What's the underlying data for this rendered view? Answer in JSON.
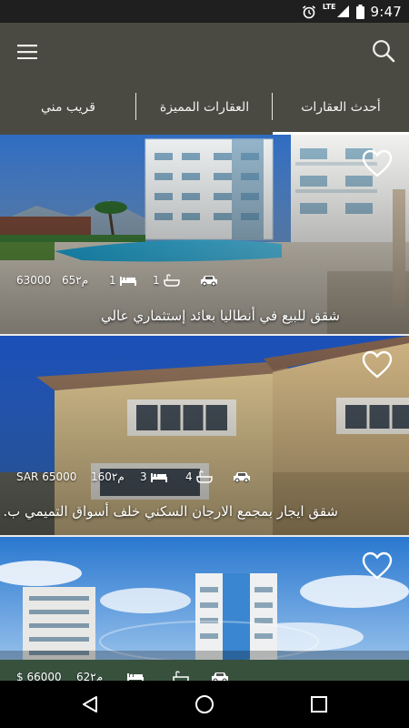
{
  "status_bar": {
    "time": "9:47",
    "network": "LTE",
    "icons": [
      "alarm-icon",
      "signal-icon",
      "battery-icon"
    ]
  },
  "app_bar": {
    "icons": [
      "menu-icon",
      "search-icon"
    ]
  },
  "tabs": [
    {
      "label": "أحدث العقارات",
      "active": true
    },
    {
      "label": "العقارات المميزة",
      "active": false
    },
    {
      "label": "قريب مني",
      "active": false
    }
  ],
  "listings": [
    {
      "title": "شقق للبيع في أنطاليا بعائد إستثماري عالي",
      "price": "63000",
      "area": "65م٢",
      "bedrooms": "1",
      "bathrooms": "1",
      "favorited": false
    },
    {
      "title": "شقق ايجار بمجمع الارجان السكني خلف أسواق التميمي ب.",
      "price": "SAR 65000",
      "area": "160م٢",
      "bedrooms": "3",
      "bathrooms": "4",
      "favorited": false
    },
    {
      "title": "",
      "price": "$ 66000",
      "area": "62م٢",
      "bedrooms": "",
      "bathrooms": "",
      "favorited": false
    }
  ],
  "nav_bar": {
    "icons": [
      "back-icon",
      "home-icon",
      "recents-icon"
    ]
  },
  "colors": {
    "app_bar": "#4a4a42",
    "status_bar": "#1f1f1f",
    "tab_text": "#f4f4f0"
  }
}
